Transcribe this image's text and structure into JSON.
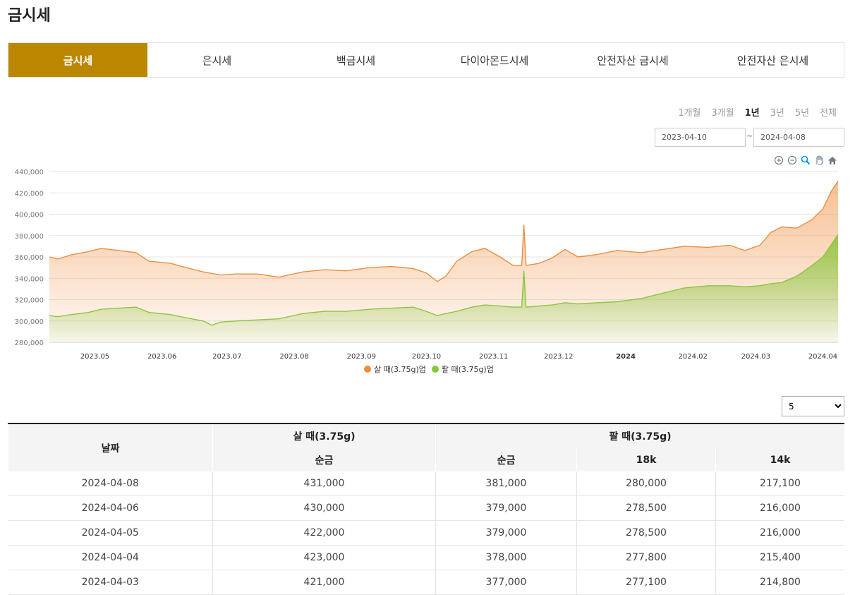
{
  "page": {
    "title": "금시세"
  },
  "tabs": [
    "금시세",
    "은시세",
    "백금시세",
    "다이아몬드시세",
    "안전자산 금시세",
    "안전자산 은시세"
  ],
  "active_tab": 0,
  "ranges": [
    "1개월",
    "3개월",
    "1년",
    "3년",
    "5년",
    "전체"
  ],
  "active_range": 2,
  "date_from": "2023-04-10",
  "date_to": "2024-04-08",
  "date_separator": "~",
  "toolbar_icons": [
    "zoom-in-icon",
    "zoom-out-icon",
    "zoom-selection-icon",
    "pan-hand-icon",
    "home-reset-icon"
  ],
  "colors": {
    "accent": "#bb8700",
    "buy": "#f08c3c",
    "sell": "#8cc63f"
  },
  "chart_data": {
    "type": "area",
    "x_ticks": [
      "2023.05",
      "2023.06",
      "2023.07",
      "2023.08",
      "2023.09",
      "2023.10",
      "2023.11",
      "2023.12",
      "2024",
      "2024.02",
      "2024.03",
      "2024.04"
    ],
    "y_ticks": [
      "440,000",
      "420,000",
      "400,000",
      "380,000",
      "360,000",
      "340,000",
      "320,000",
      "300,000",
      "280,000"
    ],
    "ylim": [
      280000,
      440000
    ],
    "xlim": [
      "2023-04-10",
      "2024-04-08"
    ],
    "grid": true,
    "legend_position": "bottom-center",
    "series": [
      {
        "name": "살 때(3.75g)업",
        "color": "#f08c3c",
        "points": [
          [
            "2023-04-10",
            360000
          ],
          [
            "2023-04-14",
            358000
          ],
          [
            "2023-04-20",
            362000
          ],
          [
            "2023-04-28",
            365000
          ],
          [
            "2023-05-04",
            368000
          ],
          [
            "2023-05-12",
            366000
          ],
          [
            "2023-05-20",
            364000
          ],
          [
            "2023-05-26",
            356000
          ],
          [
            "2023-06-05",
            354000
          ],
          [
            "2023-06-12",
            350000
          ],
          [
            "2023-06-20",
            346000
          ],
          [
            "2023-06-28",
            343000
          ],
          [
            "2023-07-05",
            344000
          ],
          [
            "2023-07-15",
            344000
          ],
          [
            "2023-07-25",
            341000
          ],
          [
            "2023-08-05",
            346000
          ],
          [
            "2023-08-15",
            348000
          ],
          [
            "2023-08-25",
            347000
          ],
          [
            "2023-09-05",
            350000
          ],
          [
            "2023-09-15",
            351000
          ],
          [
            "2023-09-25",
            349000
          ],
          [
            "2023-10-01",
            345000
          ],
          [
            "2023-10-06",
            337000
          ],
          [
            "2023-10-10",
            342000
          ],
          [
            "2023-10-15",
            356000
          ],
          [
            "2023-10-22",
            365000
          ],
          [
            "2023-10-28",
            368000
          ],
          [
            "2023-11-04",
            360000
          ],
          [
            "2023-11-10",
            352000
          ],
          [
            "2023-11-14",
            352000
          ],
          [
            "2023-11-15",
            390000
          ],
          [
            "2023-11-16",
            352000
          ],
          [
            "2023-11-22",
            354000
          ],
          [
            "2023-11-28",
            359000
          ],
          [
            "2023-12-04",
            367000
          ],
          [
            "2023-12-10",
            360000
          ],
          [
            "2023-12-18",
            362000
          ],
          [
            "2023-12-28",
            366000
          ],
          [
            "2024-01-08",
            364000
          ],
          [
            "2024-01-18",
            367000
          ],
          [
            "2024-01-28",
            370000
          ],
          [
            "2024-02-08",
            369000
          ],
          [
            "2024-02-18",
            371000
          ],
          [
            "2024-02-25",
            366000
          ],
          [
            "2024-03-03",
            371000
          ],
          [
            "2024-03-08",
            383000
          ],
          [
            "2024-03-13",
            388000
          ],
          [
            "2024-03-20",
            387000
          ],
          [
            "2024-03-27",
            395000
          ],
          [
            "2024-04-01",
            405000
          ],
          [
            "2024-04-05",
            422000
          ],
          [
            "2024-04-08",
            431000
          ]
        ]
      },
      {
        "name": "팔 때(3.75g)업",
        "color": "#8cc63f",
        "points": [
          [
            "2023-04-10",
            305000
          ],
          [
            "2023-04-14",
            304000
          ],
          [
            "2023-04-20",
            306000
          ],
          [
            "2023-04-28",
            308000
          ],
          [
            "2023-05-04",
            311000
          ],
          [
            "2023-05-12",
            312000
          ],
          [
            "2023-05-20",
            313000
          ],
          [
            "2023-05-26",
            308000
          ],
          [
            "2023-06-05",
            306000
          ],
          [
            "2023-06-12",
            303000
          ],
          [
            "2023-06-20",
            300000
          ],
          [
            "2023-06-24",
            296000
          ],
          [
            "2023-06-28",
            299000
          ],
          [
            "2023-07-05",
            300000
          ],
          [
            "2023-07-15",
            301000
          ],
          [
            "2023-07-25",
            302000
          ],
          [
            "2023-08-05",
            307000
          ],
          [
            "2023-08-15",
            309000
          ],
          [
            "2023-08-25",
            309000
          ],
          [
            "2023-09-05",
            311000
          ],
          [
            "2023-09-15",
            312000
          ],
          [
            "2023-09-25",
            313000
          ],
          [
            "2023-10-01",
            309000
          ],
          [
            "2023-10-06",
            305000
          ],
          [
            "2023-10-10",
            307000
          ],
          [
            "2023-10-15",
            309000
          ],
          [
            "2023-10-22",
            313000
          ],
          [
            "2023-10-28",
            315000
          ],
          [
            "2023-11-04",
            314000
          ],
          [
            "2023-11-10",
            313000
          ],
          [
            "2023-11-14",
            313000
          ],
          [
            "2023-11-15",
            347000
          ],
          [
            "2023-11-16",
            313000
          ],
          [
            "2023-11-22",
            314000
          ],
          [
            "2023-11-28",
            315000
          ],
          [
            "2023-12-04",
            317000
          ],
          [
            "2023-12-10",
            316000
          ],
          [
            "2023-12-18",
            317000
          ],
          [
            "2023-12-28",
            318000
          ],
          [
            "2024-01-08",
            321000
          ],
          [
            "2024-01-18",
            326000
          ],
          [
            "2024-01-28",
            331000
          ],
          [
            "2024-02-08",
            333000
          ],
          [
            "2024-02-18",
            333000
          ],
          [
            "2024-02-25",
            332000
          ],
          [
            "2024-03-03",
            333000
          ],
          [
            "2024-03-08",
            335000
          ],
          [
            "2024-03-13",
            336000
          ],
          [
            "2024-03-20",
            342000
          ],
          [
            "2024-03-27",
            352000
          ],
          [
            "2024-04-01",
            360000
          ],
          [
            "2024-04-05",
            372000
          ],
          [
            "2024-04-08",
            381000
          ]
        ]
      }
    ]
  },
  "rows_select": {
    "value": "5",
    "options": [
      "5"
    ]
  },
  "table": {
    "headers": {
      "date": "날짜",
      "buy": "살 때(3.75g)",
      "sell": "팔 때(3.75g)"
    },
    "sub_headers": {
      "buy_pure": "순금",
      "sell_pure": "순금",
      "sell_18k": "18k",
      "sell_14k": "14k"
    },
    "rows": [
      [
        "2024-04-08",
        "431,000",
        "381,000",
        "280,000",
        "217,100"
      ],
      [
        "2024-04-06",
        "430,000",
        "379,000",
        "278,500",
        "216,000"
      ],
      [
        "2024-04-05",
        "422,000",
        "379,000",
        "278,500",
        "216,000"
      ],
      [
        "2024-04-04",
        "423,000",
        "378,000",
        "277,800",
        "215,400"
      ],
      [
        "2024-04-03",
        "421,000",
        "377,000",
        "277,100",
        "214,800"
      ]
    ]
  }
}
